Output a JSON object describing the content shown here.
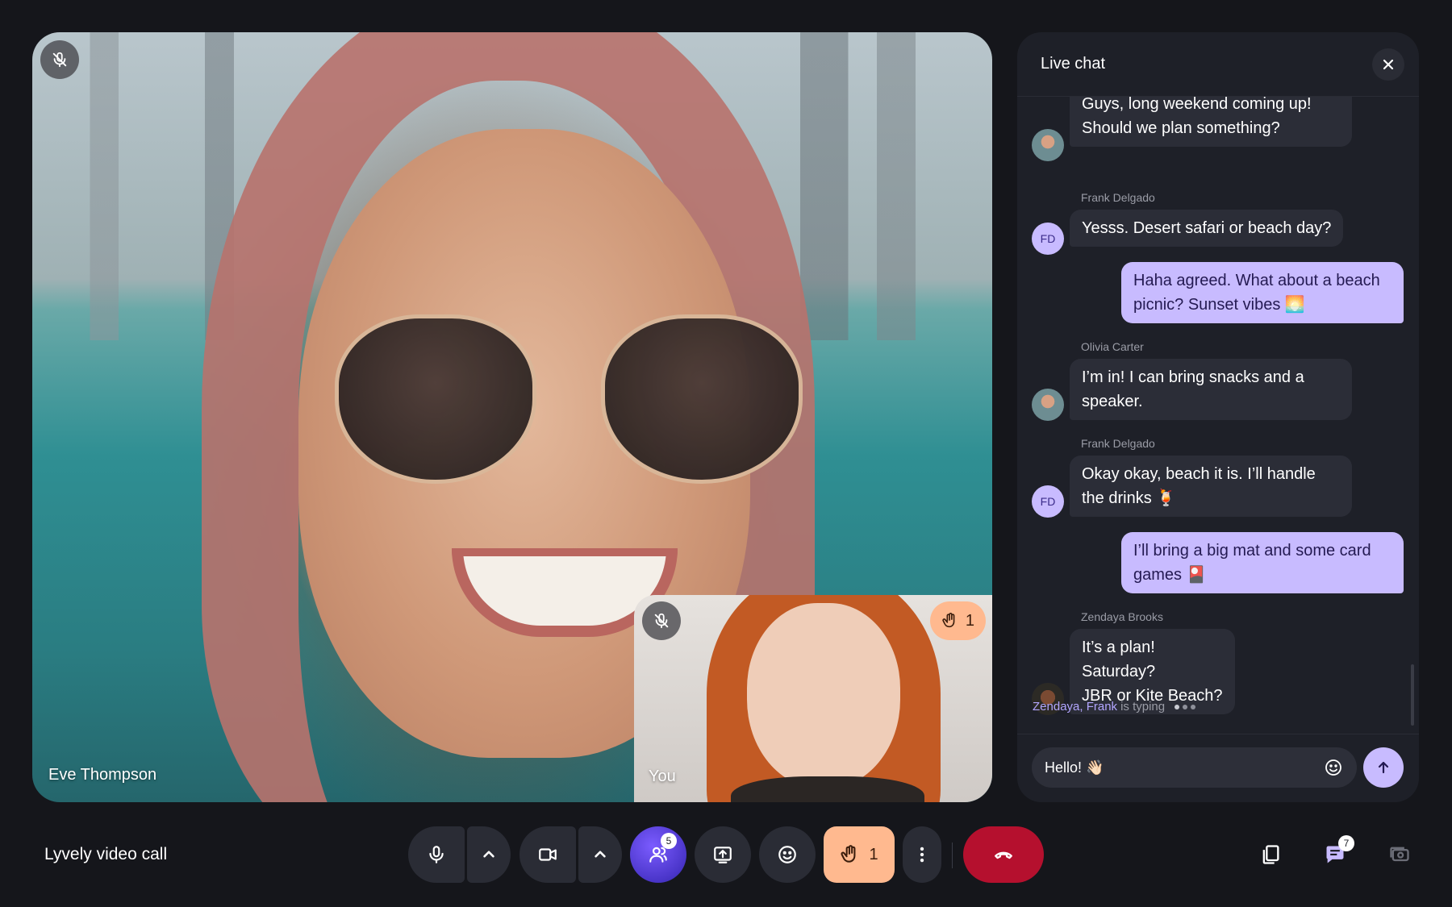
{
  "stage": {
    "participant_name": "Eve Thompson",
    "mic_state_icon": "mic-off-icon"
  },
  "self_view": {
    "label": "You",
    "mic_state_icon": "mic-off-icon",
    "hand_count": "1"
  },
  "chat": {
    "title": "Live chat",
    "messages": [
      {
        "sender": "",
        "avatar": "photo",
        "direction": "in",
        "lines": [
          "Guys, long weekend coming up!",
          "Should we plan something?"
        ]
      },
      {
        "sender": "Frank Delgado",
        "avatar": "FD",
        "direction": "in",
        "lines": [
          "Yesss. Desert safari or beach day?"
        ]
      },
      {
        "sender": "",
        "avatar": "",
        "direction": "out",
        "lines": [
          "Haha agreed. What about a beach",
          "picnic? Sunset vibes 🌅"
        ]
      },
      {
        "sender": "Olivia Carter",
        "avatar": "photo",
        "direction": "in",
        "lines": [
          "I’m in! I can bring snacks and a",
          "speaker."
        ]
      },
      {
        "sender": "Frank Delgado",
        "avatar": "FD",
        "direction": "in",
        "lines": [
          "Okay okay, beach it is. I’ll handle",
          "the drinks 🍹"
        ]
      },
      {
        "sender": "",
        "avatar": "",
        "direction": "out",
        "lines": [
          "I’ll bring a big mat and some card",
          "games 🎴"
        ]
      },
      {
        "sender": "Zendaya Brooks",
        "avatar": "photo",
        "direction": "in",
        "lines": [
          "It’s a plan!",
          "Saturday?",
          "JBR or Kite Beach?"
        ]
      }
    ],
    "typing": {
      "who": "Zendaya, Frank",
      "text": "is typing"
    },
    "input_value": "Hello! 👋🏻"
  },
  "toolbar": {
    "app_title": "Lyvely video call",
    "participants_count": "5",
    "raise_hand_count": "1",
    "chat_unread_count": "7"
  },
  "colors": {
    "accent": "#c8bbff",
    "end_call": "#b5102e",
    "raise_hand": "#ffb98f",
    "panel": "#1e2028",
    "background": "#15161b"
  }
}
